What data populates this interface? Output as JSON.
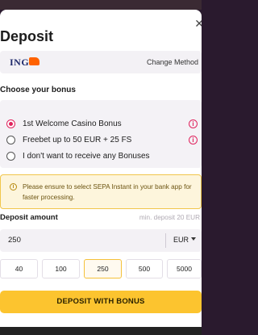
{
  "header": {
    "title": "Deposit"
  },
  "payment_method": {
    "provider": "ING",
    "change_label": "Change Method"
  },
  "bonus": {
    "heading": "Choose your bonus",
    "options": [
      {
        "label": "1st Welcome Casino Bonus",
        "selected": true,
        "has_info": true
      },
      {
        "label": "Freebet up to 50 EUR + 25 FS",
        "selected": false,
        "has_info": true
      },
      {
        "label": "I don't want to receive any Bonuses",
        "selected": false,
        "has_info": false
      }
    ]
  },
  "notice": {
    "icon": "info-icon",
    "text": "Please ensure to select SEPA Instant in your bank app for faster processing."
  },
  "amount": {
    "label": "Deposit amount",
    "min_text": "min. deposit 20 EUR",
    "value": "250",
    "currency": "EUR",
    "presets": [
      "40",
      "100",
      "250",
      "500",
      "5000"
    ],
    "selected_preset": "250"
  },
  "submit": {
    "label": "DEPOSIT WITH BONUS"
  },
  "colors": {
    "accent": "#e0245e",
    "button": "#fcc42f",
    "notice_bg": "#fdf5dc",
    "notice_border": "#f1c64b"
  }
}
